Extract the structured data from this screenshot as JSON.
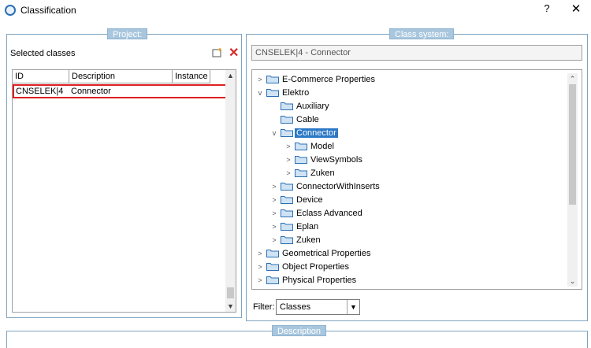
{
  "window": {
    "title": "Classification",
    "help_label": "?",
    "close_label": "✕"
  },
  "project": {
    "group_title": "Project:",
    "selected_classes_label": "Selected classes",
    "columns": [
      "ID",
      "Description",
      "Instance"
    ],
    "rows": [
      {
        "id": "CNSELEK|4",
        "description": "Connector",
        "instance": ""
      }
    ]
  },
  "class_system": {
    "group_title": "Class system:",
    "selected_path": "CNSELEK|4 - Connector",
    "tree": [
      {
        "label": "E-Commerce Properties",
        "level": 0,
        "expander": ">"
      },
      {
        "label": "Elektro",
        "level": 0,
        "expander": "v"
      },
      {
        "label": "Auxiliary",
        "level": 1,
        "expander": ""
      },
      {
        "label": "Cable",
        "level": 1,
        "expander": ""
      },
      {
        "label": "Connector",
        "level": 1,
        "expander": "v",
        "selected": true
      },
      {
        "label": "Model",
        "level": 2,
        "expander": ">"
      },
      {
        "label": "ViewSymbols",
        "level": 2,
        "expander": ">"
      },
      {
        "label": "Zuken",
        "level": 2,
        "expander": ">"
      },
      {
        "label": "ConnectorWithInserts",
        "level": 1,
        "expander": ">"
      },
      {
        "label": "Device",
        "level": 1,
        "expander": ">"
      },
      {
        "label": "Eclass Advanced",
        "level": 1,
        "expander": ">"
      },
      {
        "label": "Eplan",
        "level": 1,
        "expander": ">"
      },
      {
        "label": "Zuken",
        "level": 1,
        "expander": ">"
      },
      {
        "label": "Geometrical Properties",
        "level": 0,
        "expander": ">"
      },
      {
        "label": "Object Properties",
        "level": 0,
        "expander": ">"
      },
      {
        "label": "Physical Properties",
        "level": 0,
        "expander": ">"
      }
    ],
    "filter_label": "Filter:",
    "filter_value": "Classes"
  },
  "description": {
    "group_title": "Description"
  },
  "colors": {
    "accent": "#2b78c6",
    "group_border": "#7fa3bf",
    "group_title_bg": "#a8c6de",
    "highlight_border": "#e02020",
    "delete": "#d42a2a"
  },
  "icons": {
    "app": "app-logo-icon",
    "new": "new-class-icon",
    "delete": "delete-icon",
    "folder": "folder-icon",
    "dropdown": "chevron-down-icon"
  }
}
